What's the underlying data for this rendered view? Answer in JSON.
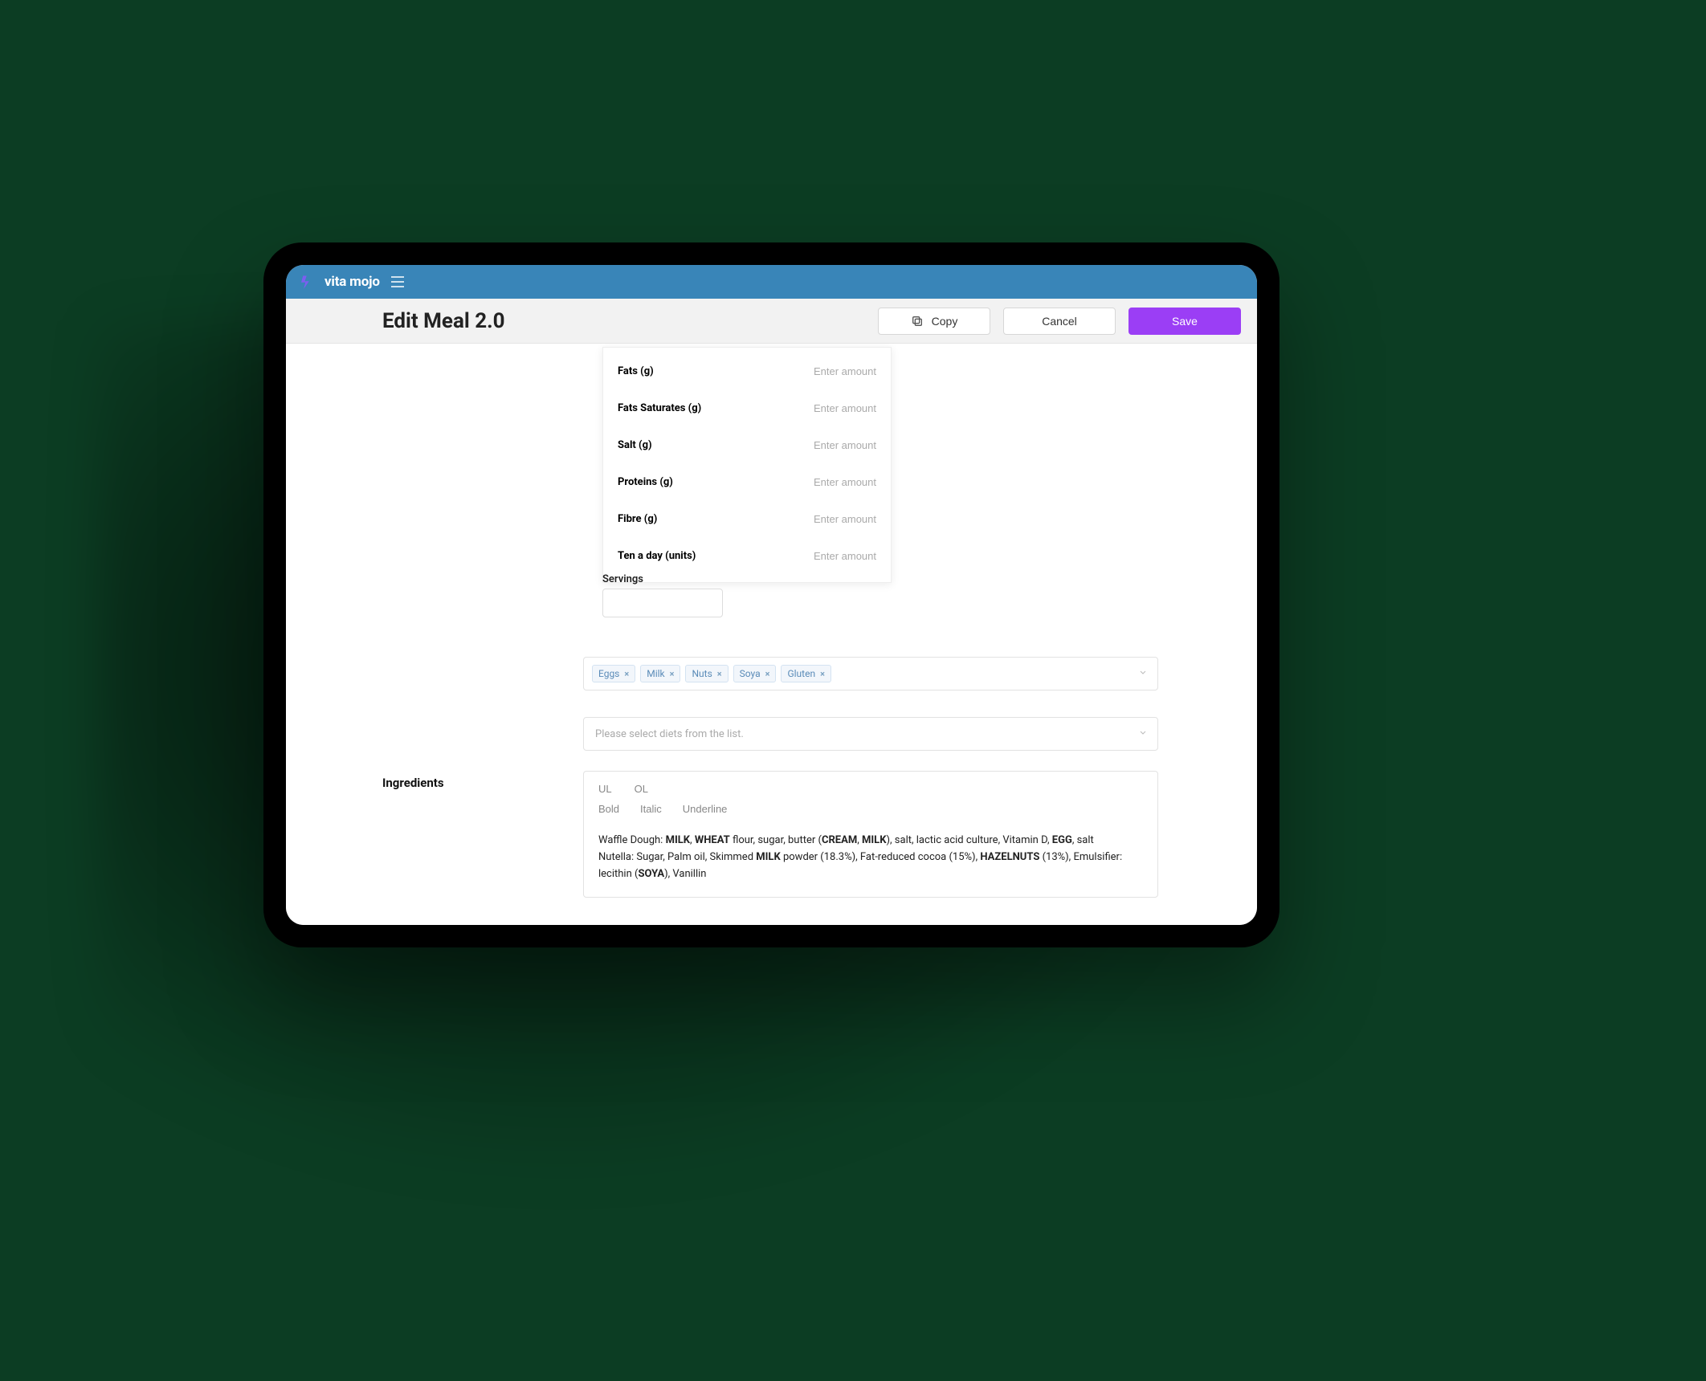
{
  "brand": "vita mojo",
  "page": {
    "title": "Edit Meal 2.0"
  },
  "actions": {
    "copy": "Copy",
    "cancel": "Cancel",
    "save": "Save"
  },
  "nutrients": [
    {
      "label": "Fats (g)",
      "placeholder": "Enter amount"
    },
    {
      "label": "Fats Saturates (g)",
      "placeholder": "Enter amount"
    },
    {
      "label": "Salt (g)",
      "placeholder": "Enter amount"
    },
    {
      "label": "Proteins (g)",
      "placeholder": "Enter amount"
    },
    {
      "label": "Fibre (g)",
      "placeholder": "Enter amount"
    },
    {
      "label": "Ten a day (units)",
      "placeholder": "Enter amount"
    }
  ],
  "servings": {
    "label": "Servings",
    "value": ""
  },
  "allergens": {
    "tags": [
      "Eggs",
      "Milk",
      "Nuts",
      "Soya",
      "Gluten"
    ]
  },
  "diets": {
    "placeholder": "Please select diets from the list."
  },
  "sections": {
    "ingredients": "Ingredients"
  },
  "editor": {
    "toolbar_list": {
      "ul": "UL",
      "ol": "OL"
    },
    "toolbar_fmt": {
      "bold": "Bold",
      "italic": "Italic",
      "underline": "Underline"
    },
    "body_segments": [
      {
        "t": "Waffle Dough: ",
        "b": false
      },
      {
        "t": "MILK",
        "b": true
      },
      {
        "t": ", ",
        "b": false
      },
      {
        "t": "WHEAT",
        "b": true
      },
      {
        "t": " flour, sugar, butter (",
        "b": false
      },
      {
        "t": "CREAM",
        "b": true
      },
      {
        "t": ", ",
        "b": false
      },
      {
        "t": "MILK",
        "b": true
      },
      {
        "t": "), salt, lactic acid culture, Vitamin D, ",
        "b": false
      },
      {
        "t": "EGG",
        "b": true
      },
      {
        "t": ", salt",
        "b": false
      },
      {
        "t": "\n",
        "b": false
      },
      {
        "t": "Nutella: Sugar, Palm oil, Skimmed ",
        "b": false
      },
      {
        "t": "MILK",
        "b": true
      },
      {
        "t": " powder (18.3%), Fat-reduced cocoa (15%), ",
        "b": false
      },
      {
        "t": "HAZELNUTS",
        "b": true
      },
      {
        "t": " (13%), Emulsifier: lecithin (",
        "b": false
      },
      {
        "t": "SOYA",
        "b": true
      },
      {
        "t": "), Vanillin",
        "b": false
      }
    ]
  }
}
